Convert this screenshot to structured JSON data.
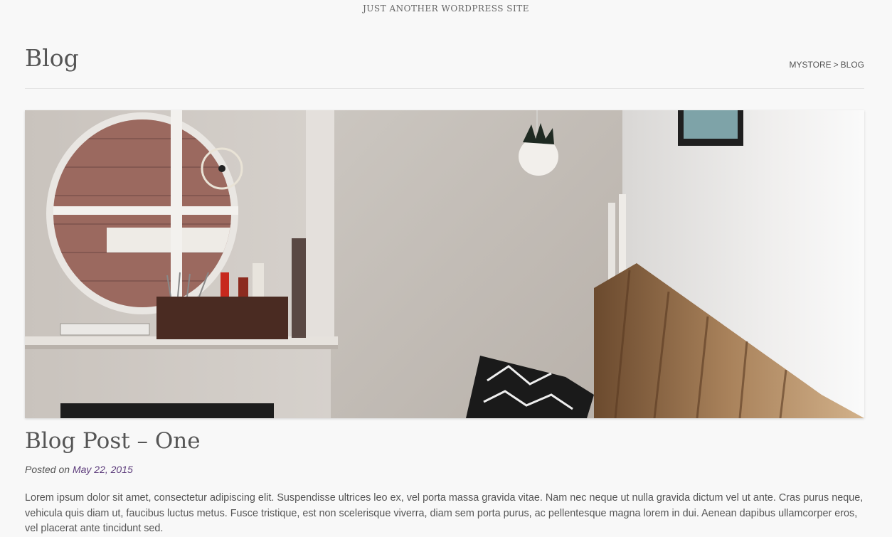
{
  "site": {
    "tagline": "JUST ANOTHER WORDPRESS SITE"
  },
  "page": {
    "title": "Blog"
  },
  "breadcrumb": {
    "home": "MYSTORE",
    "separator": ">",
    "current": "BLOG"
  },
  "featured_image": {
    "icon": "photo-interior-round-window"
  },
  "post": {
    "title": "Blog Post – One",
    "meta_prefix": "Posted on",
    "date": "May 22, 2015",
    "excerpt": "Lorem ipsum dolor sit amet, consectetur adipiscing elit. Suspendisse ultrices leo ex, vel porta massa gravida vitae. Nam nec neque ut nulla gravida dictum vel ut ante. Cras purus neque, vehicula quis diam ut, faucibus luctus metus. Fusce tristique, est non scelerisque viverra, diam sem porta purus, ac pellentesque magna lorem in dui. Aenean dapibus ullamcorper eros, vel placerat ante tincidunt sed."
  },
  "colors": {
    "background": "#f8f8f8",
    "text": "#555555",
    "link": "#5b3a7a",
    "divider": "#e3e3e3"
  }
}
